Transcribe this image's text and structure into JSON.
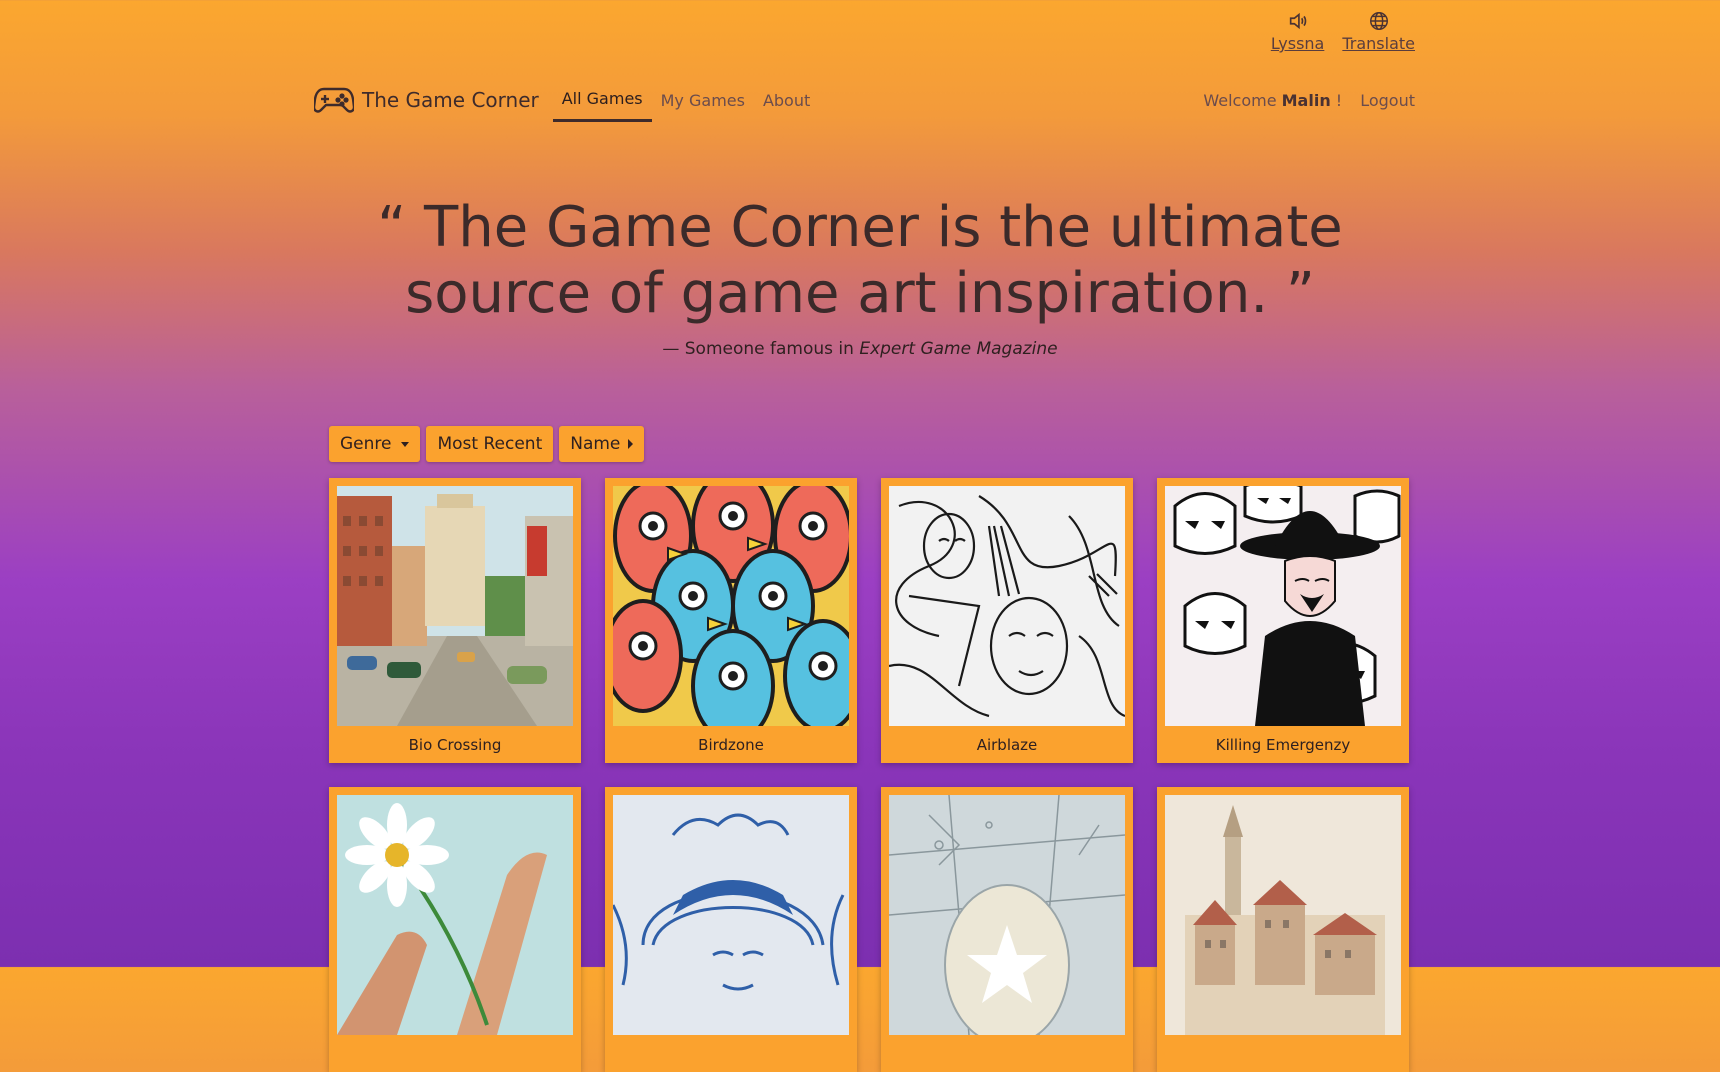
{
  "a11y": {
    "listen_label": "Lyssna",
    "translate_label": "Translate",
    "listen_icon": "speaker-icon",
    "translate_icon": "globe-icon"
  },
  "nav": {
    "brand": "The Game Corner",
    "brand_icon": "gamepad-icon",
    "links": [
      {
        "label": "All Games",
        "active": true
      },
      {
        "label": "My Games",
        "active": false
      },
      {
        "label": "About",
        "active": false
      }
    ],
    "welcome_prefix": "Welcome",
    "username": "Malin",
    "welcome_suffix": "!",
    "logout": "Logout"
  },
  "hero": {
    "quote": "“ The Game Corner is the ultimate source of game art inspiration. ”",
    "attribution_prefix": "— Someone famous in",
    "attribution_source": "Expert Game Magazine"
  },
  "filters": {
    "genre": "Genre",
    "most_recent": "Most Recent",
    "name": "Name"
  },
  "games": [
    {
      "title": "Bio Crossing",
      "thumb": "street-scene"
    },
    {
      "title": "Birdzone",
      "thumb": "colorful-birds"
    },
    {
      "title": "Airblaze",
      "thumb": "line-art-faces"
    },
    {
      "title": "Killing Emergenzy",
      "thumb": "stormtroopers"
    },
    {
      "title": "",
      "thumb": "hands-daisy"
    },
    {
      "title": "",
      "thumb": "blue-portrait"
    },
    {
      "title": "",
      "thumb": "star-map"
    },
    {
      "title": "",
      "thumb": "watercolor-town"
    }
  ],
  "colors": {
    "accent": "#fba22e",
    "gradient_top": "#fba72f",
    "gradient_bottom": "#7c2fb0"
  }
}
